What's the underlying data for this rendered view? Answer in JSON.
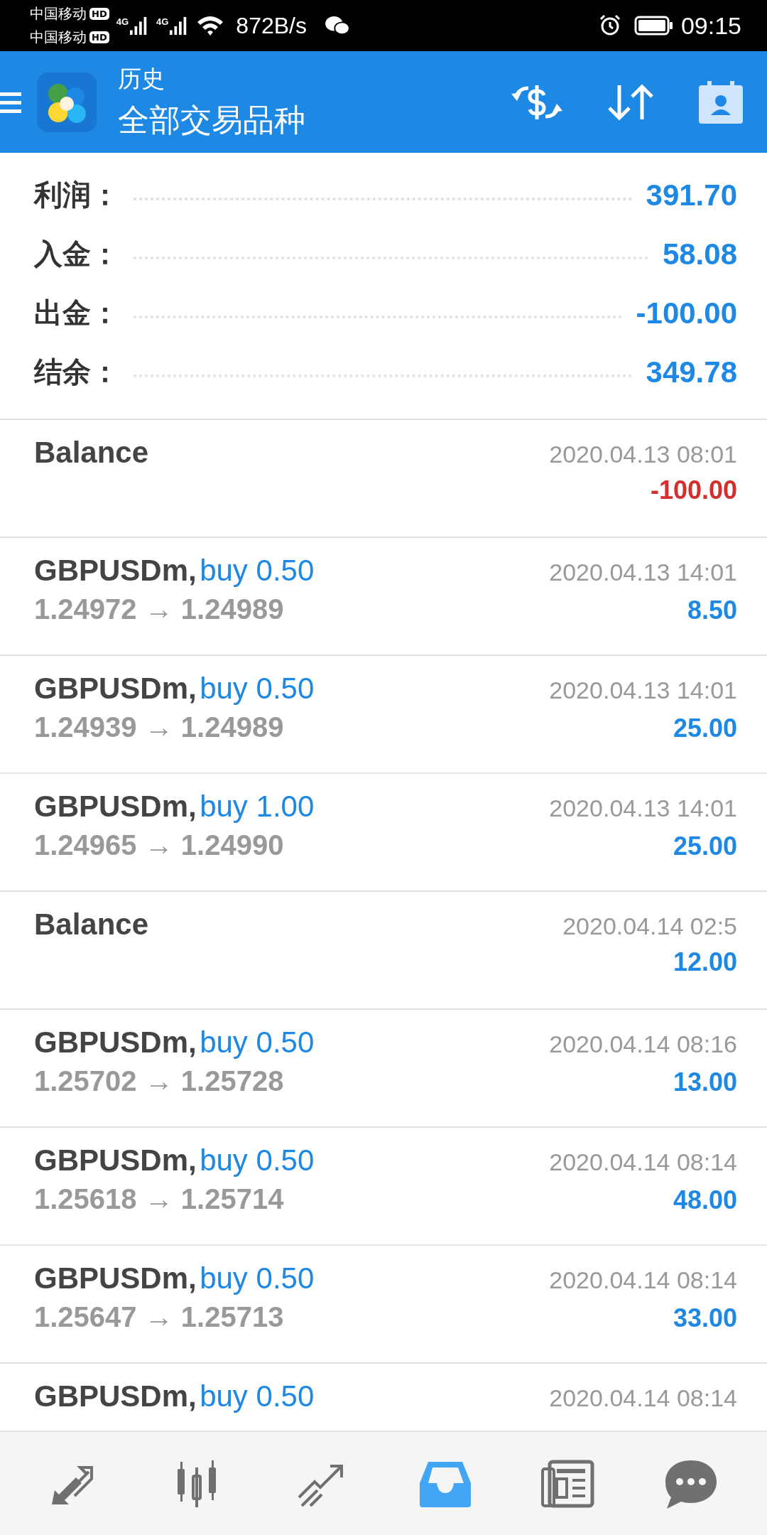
{
  "status_bar": {
    "carriers": [
      {
        "name": "中国移动",
        "badge": "HD"
      },
      {
        "name": "中国移动",
        "badge": "HD"
      }
    ],
    "network": [
      "4G",
      "4G"
    ],
    "speed": "872B/s",
    "time": "09:15"
  },
  "app_bar": {
    "title": "历史",
    "subtitle": "全部交易品种"
  },
  "summary": [
    {
      "label": "利润：",
      "value": "391.70"
    },
    {
      "label": "入金：",
      "value": "58.08"
    },
    {
      "label": "出金：",
      "value": "-100.00"
    },
    {
      "label": "结余：",
      "value": "349.78"
    }
  ],
  "deals": [
    {
      "kind": "balance",
      "title": "Balance",
      "time": "2020.04.13 08:01",
      "amount": "-100.00",
      "loss": true
    },
    {
      "kind": "trade",
      "title": "GBPUSDm,",
      "side": "buy 0.50",
      "prices": "1.24972 → 1.24989",
      "time": "2020.04.13 14:01",
      "amount": "8.50",
      "loss": false
    },
    {
      "kind": "trade",
      "title": "GBPUSDm,",
      "side": "buy 0.50",
      "prices": "1.24939 → 1.24989",
      "time": "2020.04.13 14:01",
      "amount": "25.00",
      "loss": false
    },
    {
      "kind": "trade",
      "title": "GBPUSDm,",
      "side": "buy 1.00",
      "prices": "1.24965 → 1.24990",
      "time": "2020.04.13 14:01",
      "amount": "25.00",
      "loss": false
    },
    {
      "kind": "balance",
      "title": "Balance",
      "time": "2020.04.14 02:5",
      "amount": "12.00",
      "loss": false
    },
    {
      "kind": "trade",
      "title": "GBPUSDm,",
      "side": "buy 0.50",
      "prices": "1.25702 → 1.25728",
      "time": "2020.04.14 08:16",
      "amount": "13.00",
      "loss": false
    },
    {
      "kind": "trade",
      "title": "GBPUSDm,",
      "side": "buy 0.50",
      "prices": "1.25618 → 1.25714",
      "time": "2020.04.14 08:14",
      "amount": "48.00",
      "loss": false
    },
    {
      "kind": "trade",
      "title": "GBPUSDm,",
      "side": "buy 0.50",
      "prices": "1.25647 → 1.25713",
      "time": "2020.04.14 08:14",
      "amount": "33.00",
      "loss": false
    },
    {
      "kind": "partial",
      "title": "GBPUSDm,",
      "side": "buy 0.50",
      "time": "2020.04.14 08:14"
    }
  ],
  "nav": [
    {
      "kind": "trade",
      "selected": false
    },
    {
      "kind": "quotes",
      "selected": false
    },
    {
      "kind": "chart",
      "selected": false
    },
    {
      "kind": "history",
      "selected": true
    },
    {
      "kind": "news",
      "selected": false
    },
    {
      "kind": "chat",
      "selected": false
    }
  ]
}
